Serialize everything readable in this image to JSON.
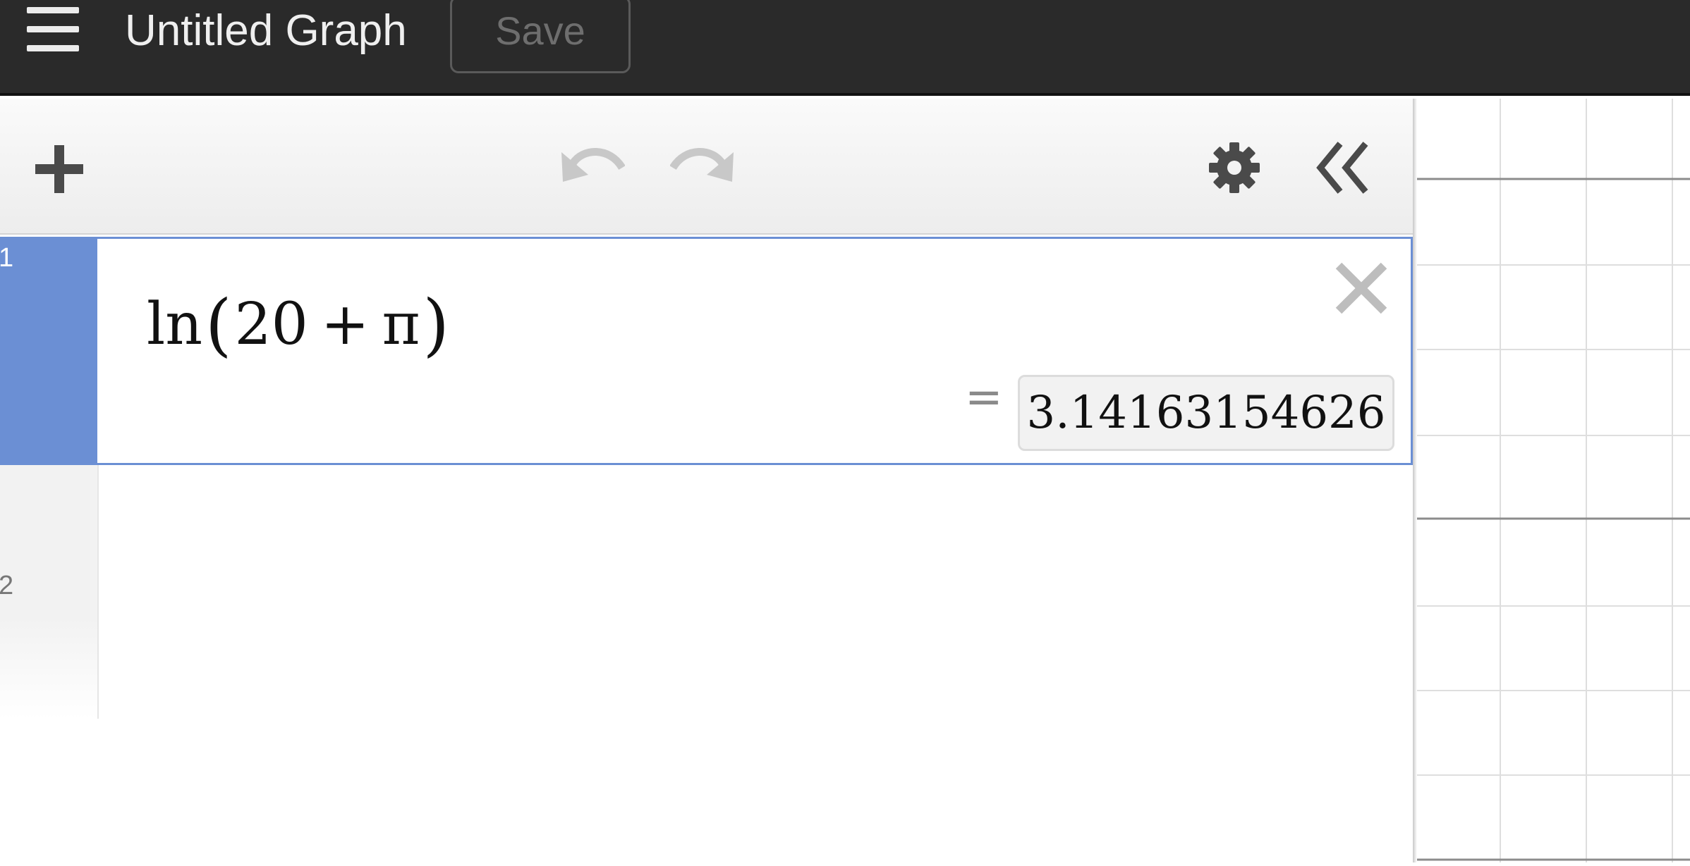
{
  "header": {
    "title": "Untitled Graph",
    "save_label": "Save"
  },
  "toolbar": {
    "add_icon": "plus-icon",
    "undo_icon": "undo-icon",
    "redo_icon": "redo-icon",
    "settings_icon": "gear-icon",
    "collapse_icon": "double-chevron-left-icon"
  },
  "expressions": [
    {
      "number": "1",
      "latex_display": "ln(20 + π)",
      "parts": {
        "fn": "ln",
        "arg_a": "20",
        "op": "+",
        "arg_b": "π"
      },
      "equals": "=",
      "result": "3.14163154626"
    },
    {
      "number": "2",
      "latex_display": ""
    }
  ],
  "colors": {
    "topbar": "#2a2a2a",
    "active_row": "#6b8fd4",
    "result_bg": "#f2f2f2"
  }
}
